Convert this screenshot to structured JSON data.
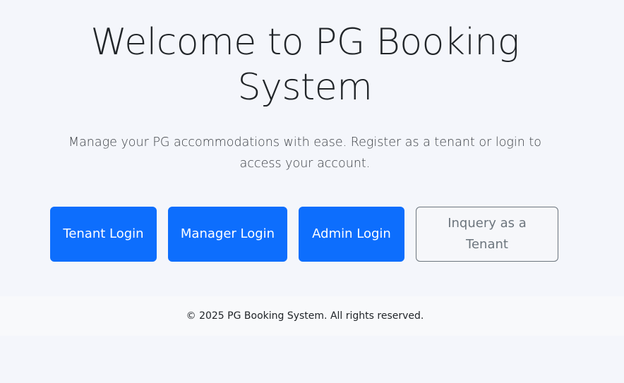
{
  "hero": {
    "title": "Welcome to PG Booking System",
    "lead": "Manage your PG accommodations with ease. Register as a tenant or login to access your account."
  },
  "actions": {
    "tenant_login": "Tenant Login",
    "manager_login": "Manager Login",
    "admin_login": "Admin Login",
    "inquiry": "Inquery as a Tenant"
  },
  "footer": {
    "copyright": "© 2025 PG Booking System. All rights reserved."
  },
  "colors": {
    "primary": "#0d6efd",
    "secondary": "#6c757d",
    "background": "#f4f6fb"
  }
}
